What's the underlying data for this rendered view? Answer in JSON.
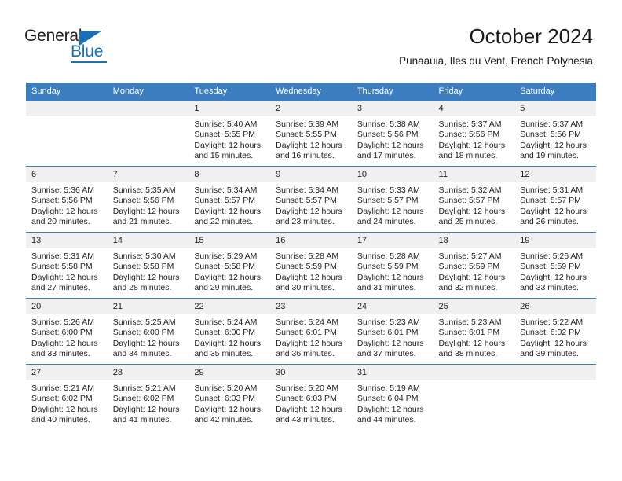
{
  "branding": {
    "logo_word_1": "General",
    "logo_word_2": "Blue",
    "accent_color": "#1c6fb5"
  },
  "header": {
    "title": "October 2024",
    "subtitle": "Punaauia, Iles du Vent, French Polynesia"
  },
  "theme": {
    "header_row_bg": "#3b7dbf",
    "daynum_bg": "#f0f0f0",
    "text_color": "#222222"
  },
  "labels": {
    "sunrise_prefix": "Sunrise:",
    "sunset_prefix": "Sunset:",
    "daylight_prefix": "Daylight:"
  },
  "weekdays": [
    "Sunday",
    "Monday",
    "Tuesday",
    "Wednesday",
    "Thursday",
    "Friday",
    "Saturday"
  ],
  "weeks": [
    [
      {
        "day": "",
        "empty": true
      },
      {
        "day": "",
        "empty": true
      },
      {
        "day": "1",
        "sunrise": "Sunrise: 5:40 AM",
        "sunset": "Sunset: 5:55 PM",
        "daylight": "Daylight: 12 hours and 15 minutes."
      },
      {
        "day": "2",
        "sunrise": "Sunrise: 5:39 AM",
        "sunset": "Sunset: 5:55 PM",
        "daylight": "Daylight: 12 hours and 16 minutes."
      },
      {
        "day": "3",
        "sunrise": "Sunrise: 5:38 AM",
        "sunset": "Sunset: 5:56 PM",
        "daylight": "Daylight: 12 hours and 17 minutes."
      },
      {
        "day": "4",
        "sunrise": "Sunrise: 5:37 AM",
        "sunset": "Sunset: 5:56 PM",
        "daylight": "Daylight: 12 hours and 18 minutes."
      },
      {
        "day": "5",
        "sunrise": "Sunrise: 5:37 AM",
        "sunset": "Sunset: 5:56 PM",
        "daylight": "Daylight: 12 hours and 19 minutes."
      }
    ],
    [
      {
        "day": "6",
        "sunrise": "Sunrise: 5:36 AM",
        "sunset": "Sunset: 5:56 PM",
        "daylight": "Daylight: 12 hours and 20 minutes."
      },
      {
        "day": "7",
        "sunrise": "Sunrise: 5:35 AM",
        "sunset": "Sunset: 5:56 PM",
        "daylight": "Daylight: 12 hours and 21 minutes."
      },
      {
        "day": "8",
        "sunrise": "Sunrise: 5:34 AM",
        "sunset": "Sunset: 5:57 PM",
        "daylight": "Daylight: 12 hours and 22 minutes."
      },
      {
        "day": "9",
        "sunrise": "Sunrise: 5:34 AM",
        "sunset": "Sunset: 5:57 PM",
        "daylight": "Daylight: 12 hours and 23 minutes."
      },
      {
        "day": "10",
        "sunrise": "Sunrise: 5:33 AM",
        "sunset": "Sunset: 5:57 PM",
        "daylight": "Daylight: 12 hours and 24 minutes."
      },
      {
        "day": "11",
        "sunrise": "Sunrise: 5:32 AM",
        "sunset": "Sunset: 5:57 PM",
        "daylight": "Daylight: 12 hours and 25 minutes."
      },
      {
        "day": "12",
        "sunrise": "Sunrise: 5:31 AM",
        "sunset": "Sunset: 5:57 PM",
        "daylight": "Daylight: 12 hours and 26 minutes."
      }
    ],
    [
      {
        "day": "13",
        "sunrise": "Sunrise: 5:31 AM",
        "sunset": "Sunset: 5:58 PM",
        "daylight": "Daylight: 12 hours and 27 minutes."
      },
      {
        "day": "14",
        "sunrise": "Sunrise: 5:30 AM",
        "sunset": "Sunset: 5:58 PM",
        "daylight": "Daylight: 12 hours and 28 minutes."
      },
      {
        "day": "15",
        "sunrise": "Sunrise: 5:29 AM",
        "sunset": "Sunset: 5:58 PM",
        "daylight": "Daylight: 12 hours and 29 minutes."
      },
      {
        "day": "16",
        "sunrise": "Sunrise: 5:28 AM",
        "sunset": "Sunset: 5:59 PM",
        "daylight": "Daylight: 12 hours and 30 minutes."
      },
      {
        "day": "17",
        "sunrise": "Sunrise: 5:28 AM",
        "sunset": "Sunset: 5:59 PM",
        "daylight": "Daylight: 12 hours and 31 minutes."
      },
      {
        "day": "18",
        "sunrise": "Sunrise: 5:27 AM",
        "sunset": "Sunset: 5:59 PM",
        "daylight": "Daylight: 12 hours and 32 minutes."
      },
      {
        "day": "19",
        "sunrise": "Sunrise: 5:26 AM",
        "sunset": "Sunset: 5:59 PM",
        "daylight": "Daylight: 12 hours and 33 minutes."
      }
    ],
    [
      {
        "day": "20",
        "sunrise": "Sunrise: 5:26 AM",
        "sunset": "Sunset: 6:00 PM",
        "daylight": "Daylight: 12 hours and 33 minutes."
      },
      {
        "day": "21",
        "sunrise": "Sunrise: 5:25 AM",
        "sunset": "Sunset: 6:00 PM",
        "daylight": "Daylight: 12 hours and 34 minutes."
      },
      {
        "day": "22",
        "sunrise": "Sunrise: 5:24 AM",
        "sunset": "Sunset: 6:00 PM",
        "daylight": "Daylight: 12 hours and 35 minutes."
      },
      {
        "day": "23",
        "sunrise": "Sunrise: 5:24 AM",
        "sunset": "Sunset: 6:01 PM",
        "daylight": "Daylight: 12 hours and 36 minutes."
      },
      {
        "day": "24",
        "sunrise": "Sunrise: 5:23 AM",
        "sunset": "Sunset: 6:01 PM",
        "daylight": "Daylight: 12 hours and 37 minutes."
      },
      {
        "day": "25",
        "sunrise": "Sunrise: 5:23 AM",
        "sunset": "Sunset: 6:01 PM",
        "daylight": "Daylight: 12 hours and 38 minutes."
      },
      {
        "day": "26",
        "sunrise": "Sunrise: 5:22 AM",
        "sunset": "Sunset: 6:02 PM",
        "daylight": "Daylight: 12 hours and 39 minutes."
      }
    ],
    [
      {
        "day": "27",
        "sunrise": "Sunrise: 5:21 AM",
        "sunset": "Sunset: 6:02 PM",
        "daylight": "Daylight: 12 hours and 40 minutes."
      },
      {
        "day": "28",
        "sunrise": "Sunrise: 5:21 AM",
        "sunset": "Sunset: 6:02 PM",
        "daylight": "Daylight: 12 hours and 41 minutes."
      },
      {
        "day": "29",
        "sunrise": "Sunrise: 5:20 AM",
        "sunset": "Sunset: 6:03 PM",
        "daylight": "Daylight: 12 hours and 42 minutes."
      },
      {
        "day": "30",
        "sunrise": "Sunrise: 5:20 AM",
        "sunset": "Sunset: 6:03 PM",
        "daylight": "Daylight: 12 hours and 43 minutes."
      },
      {
        "day": "31",
        "sunrise": "Sunrise: 5:19 AM",
        "sunset": "Sunset: 6:04 PM",
        "daylight": "Daylight: 12 hours and 44 minutes."
      },
      {
        "day": "",
        "empty": true
      },
      {
        "day": "",
        "empty": true
      }
    ]
  ]
}
